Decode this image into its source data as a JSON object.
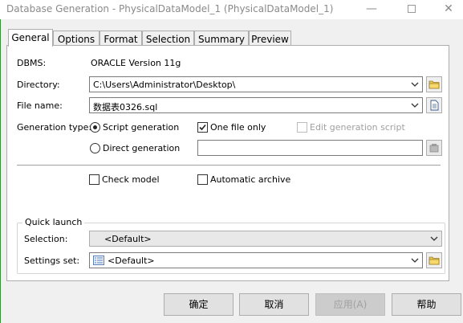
{
  "window": {
    "title": "Database Generation - PhysicalDataModel_1 (PhysicalDataModel_1)",
    "minimize_glyph": "—",
    "close_glyph": "✕"
  },
  "tabs": [
    {
      "label": "General",
      "active": true
    },
    {
      "label": "Options",
      "active": false
    },
    {
      "label": "Format",
      "active": false
    },
    {
      "label": "Selection",
      "active": false
    },
    {
      "label": "Summary",
      "active": false
    },
    {
      "label": "Preview",
      "active": false
    }
  ],
  "general": {
    "dbms_label": "DBMS:",
    "dbms_value": "ORACLE Version 11g",
    "directory_label": "Directory:",
    "directory_value": "C:\\Users\\Administrator\\Desktop\\",
    "filename_label": "File name:",
    "filename_value": "数据表0326.sql",
    "generation_type_label": "Generation type:",
    "script_generation": {
      "label": "Script generation",
      "selected": true
    },
    "direct_generation": {
      "label": "Direct generation",
      "selected": false
    },
    "one_file_only": {
      "label": "One file only",
      "checked": true
    },
    "edit_generation_script": {
      "label": "Edit generation script",
      "checked": false,
      "enabled": false
    },
    "direct_generation_value": "",
    "check_model": {
      "label": "Check model",
      "checked": false
    },
    "automatic_archive": {
      "label": "Automatic archive",
      "checked": false
    }
  },
  "quick_launch": {
    "title": "Quick launch",
    "selection_label": "Selection:",
    "selection_value": "<Default>",
    "settings_label": "Settings set:",
    "settings_value": "<Default>"
  },
  "buttons": {
    "ok": "确定",
    "cancel": "取消",
    "apply": "应用(A)",
    "help": "帮助"
  },
  "colors": {
    "accent_left_edge": "#3b8f3b",
    "title_text": "#8a8a8a"
  }
}
